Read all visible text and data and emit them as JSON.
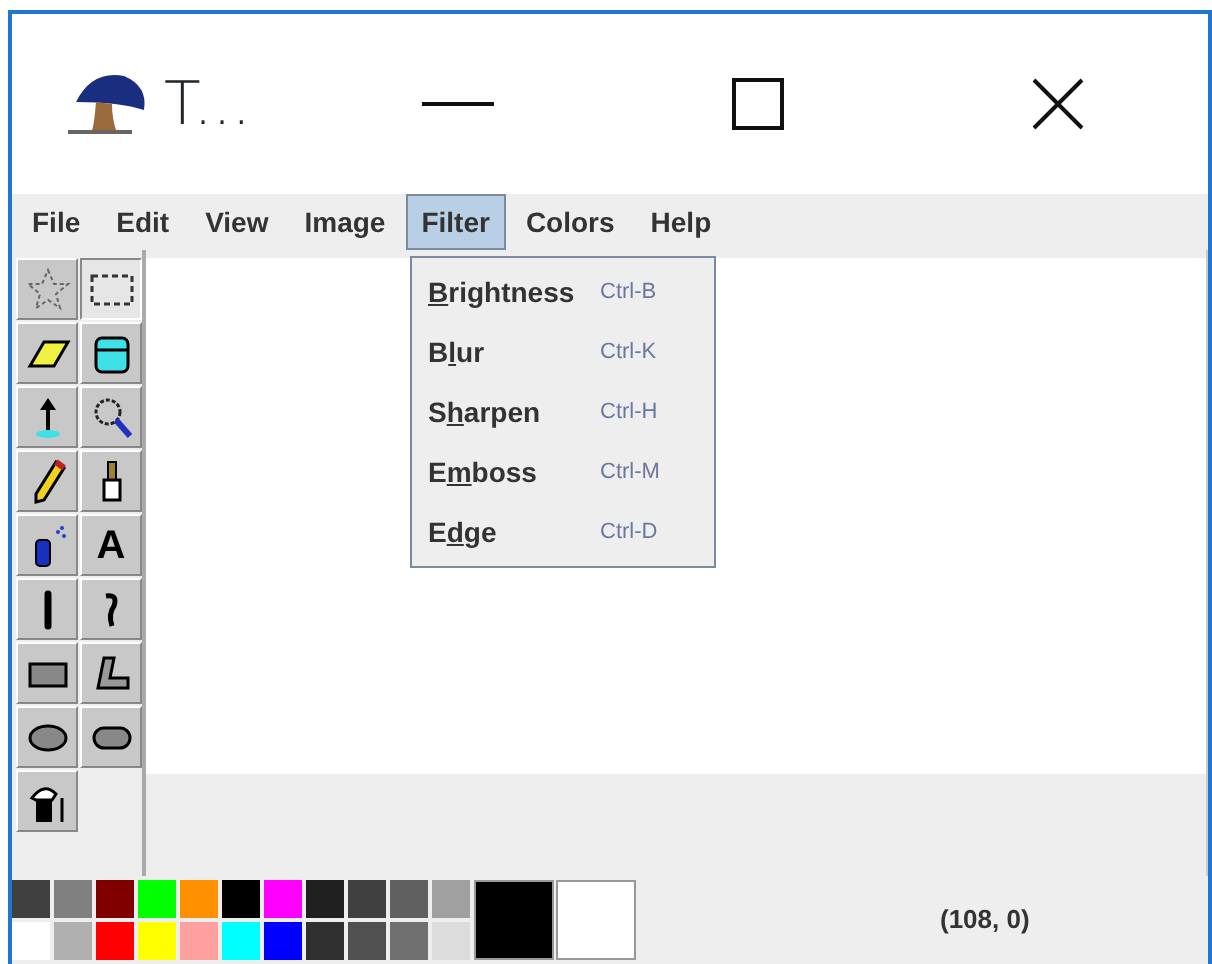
{
  "window": {
    "title": "T..."
  },
  "menu": [
    {
      "label": "File",
      "selected": false
    },
    {
      "label": "Edit",
      "selected": false
    },
    {
      "label": "View",
      "selected": false
    },
    {
      "label": "Image",
      "selected": false
    },
    {
      "label": "Filter",
      "selected": true
    },
    {
      "label": "Colors",
      "selected": false
    },
    {
      "label": "Help",
      "selected": false
    }
  ],
  "dropdown": [
    {
      "key": "B",
      "after": "rightness",
      "shortcut": "Ctrl-B"
    },
    {
      "before": "B",
      "key": "l",
      "after": "ur",
      "shortcut": "Ctrl-K"
    },
    {
      "before": "S",
      "key": "h",
      "after": "arpen",
      "shortcut": "Ctrl-H"
    },
    {
      "before": "E",
      "key": "m",
      "after": "boss",
      "shortcut": "Ctrl-M"
    },
    {
      "before": "E",
      "key": "d",
      "after": "ge",
      "shortcut": "Ctrl-D"
    }
  ],
  "tools": [
    {
      "kind": "free-select",
      "selected": false
    },
    {
      "kind": "rect-select",
      "selected": true
    },
    {
      "kind": "eraser",
      "selected": false
    },
    {
      "kind": "fill",
      "selected": false
    },
    {
      "kind": "picker",
      "selected": false
    },
    {
      "kind": "magnifier",
      "selected": false
    },
    {
      "kind": "pencil",
      "selected": false
    },
    {
      "kind": "brush",
      "selected": false
    },
    {
      "kind": "airbrush",
      "selected": false
    },
    {
      "kind": "text",
      "glyph": "A",
      "selected": false
    },
    {
      "kind": "line",
      "selected": false
    },
    {
      "kind": "curve",
      "selected": false
    },
    {
      "kind": "rectangle",
      "selected": false
    },
    {
      "kind": "polygon",
      "selected": false
    },
    {
      "kind": "ellipse",
      "selected": false
    },
    {
      "kind": "rounded-rect",
      "selected": false
    },
    {
      "kind": "fill-style",
      "selected": false
    }
  ],
  "palette": [
    {
      "color": "#404040"
    },
    {
      "color": "#ffffff"
    },
    {
      "color": "#808080"
    },
    {
      "color": "#b0b0b0"
    },
    {
      "color": "#800000"
    },
    {
      "color": "#ff0000"
    },
    {
      "color": "#00ff00"
    },
    {
      "color": "#ffff00"
    },
    {
      "color": "#ff9000"
    },
    {
      "color": "#ffa0a0"
    },
    {
      "color": "#000000"
    },
    {
      "color": "#00ffff"
    },
    {
      "color": "#ff00ff"
    },
    {
      "color": "#0000ff"
    },
    {
      "color": "#202020"
    },
    {
      "color": "#303030"
    },
    {
      "color": "#404040"
    },
    {
      "color": "#505050"
    },
    {
      "color": "#606060"
    },
    {
      "color": "#707070"
    },
    {
      "color": "#a0a0a0"
    },
    {
      "color": "#dcdcdc"
    }
  ],
  "foreground": {
    "color": "#000000"
  },
  "background": {
    "color": "#ffffff"
  },
  "status_bar": {
    "coordinates": "(108, 0)"
  }
}
